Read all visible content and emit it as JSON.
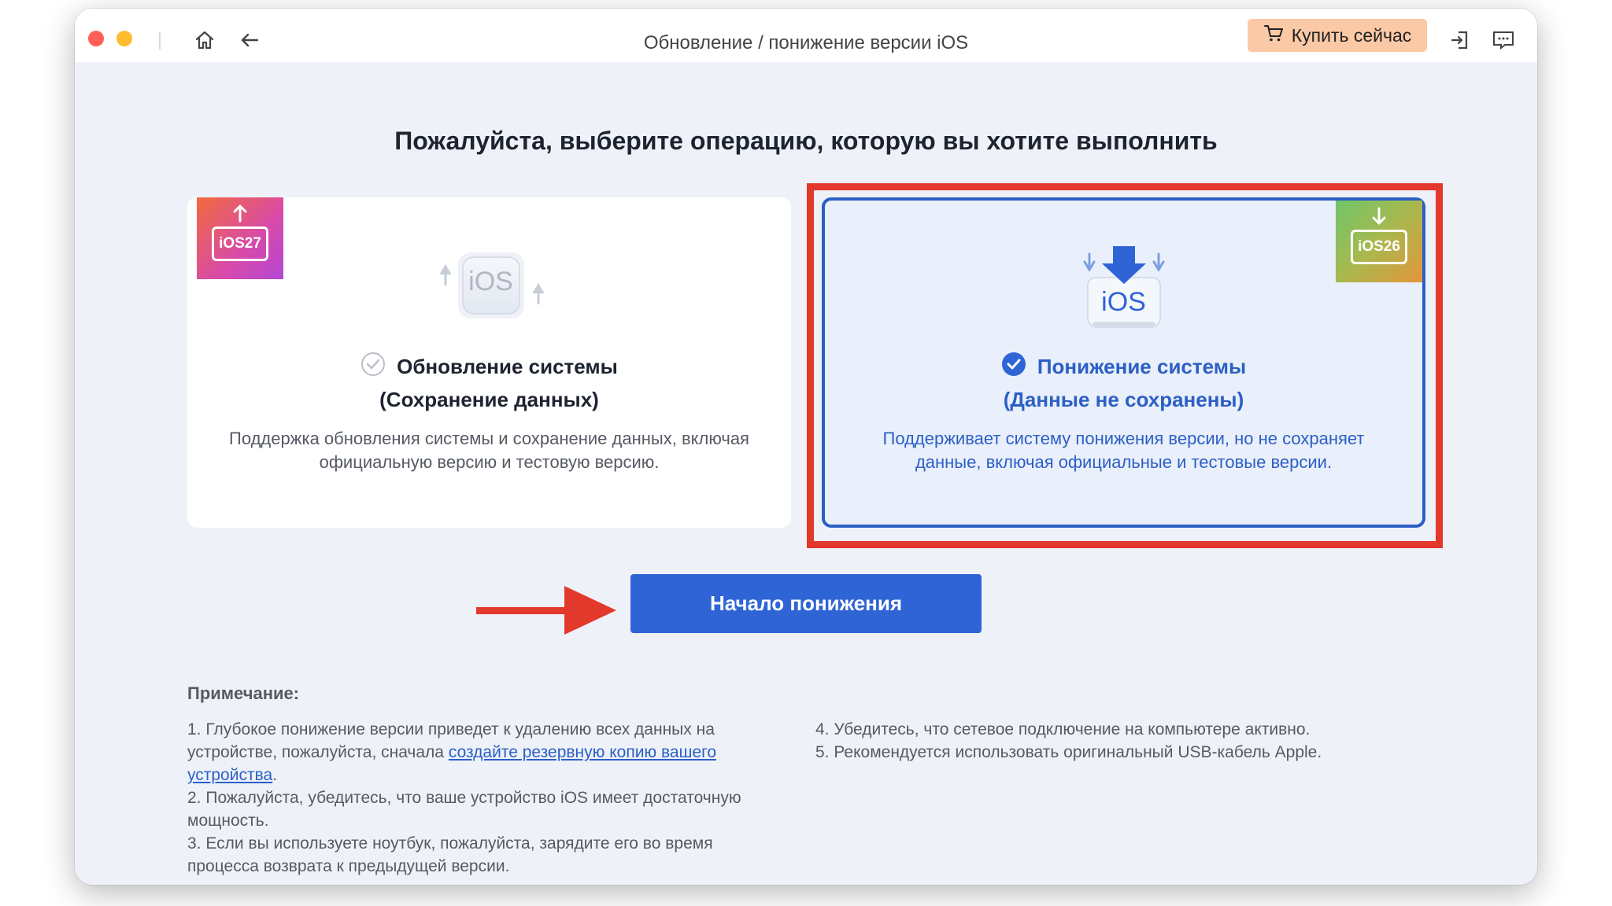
{
  "window": {
    "title": "Обновление / понижение версии iOS",
    "buy_label": "Купить сейчас"
  },
  "heading": "Пожалуйста, выберите операцию, которую вы хотите выполнить",
  "options": [
    {
      "badge": "iOS27",
      "icon_label": "iOS",
      "title": "Обновление системы",
      "subtitle": "(Сохранение данных)",
      "description": "Поддержка обновления системы и сохранение данных, включая официальную версию и тестовую версию.",
      "selected": false
    },
    {
      "badge": "iOS26",
      "icon_label": "iOS",
      "title": "Понижение системы",
      "subtitle": "(Данные не сохранены)",
      "description": "Поддерживает систему понижения версии, но не сохраняет данные, включая официальные и тестовые версии.",
      "selected": true
    }
  ],
  "start_button": "Начало понижения",
  "notes": {
    "title": "Примечание:",
    "item1_before": "1. Глубокое понижение версии приведет к удалению всех данных на устройстве, пожалуйста, сначала ",
    "item1_link": "создайте резервную копию вашего устройства",
    "item1_after": ".",
    "item2": "2. Пожалуйста, убедитесь, что ваше устройство iOS имеет достаточную мощность.",
    "item3": "3. Если вы используете ноутбук, пожалуйста, зарядите его во время процесса возврата к предыдущей версии.",
    "item4": "4. Убедитесь, что сетевое подключение на компьютере активно.",
    "item5": "5. Рекомендуется использовать оригинальный USB-кабель Apple."
  },
  "colors": {
    "accent": "#2f64d6",
    "highlight": "#e3382c",
    "buy_button": "#fcc9a6"
  }
}
